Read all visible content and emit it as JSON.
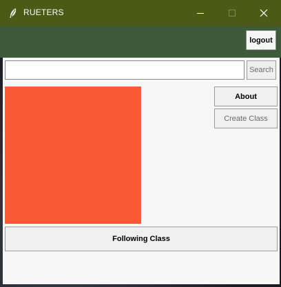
{
  "window": {
    "title": "RUETERS",
    "titlebar_color": "#4b5a16",
    "icon": "feather-icon"
  },
  "header": {
    "background": "#3e5a3a",
    "logout_label": "logout"
  },
  "search": {
    "value": "",
    "placeholder": "",
    "button_label": "Search"
  },
  "canvas": {
    "color": "#fb5a36"
  },
  "side_buttons": {
    "about_label": "About",
    "create_class_label": "Create Class"
  },
  "footer": {
    "following_class_label": "Following Class"
  }
}
